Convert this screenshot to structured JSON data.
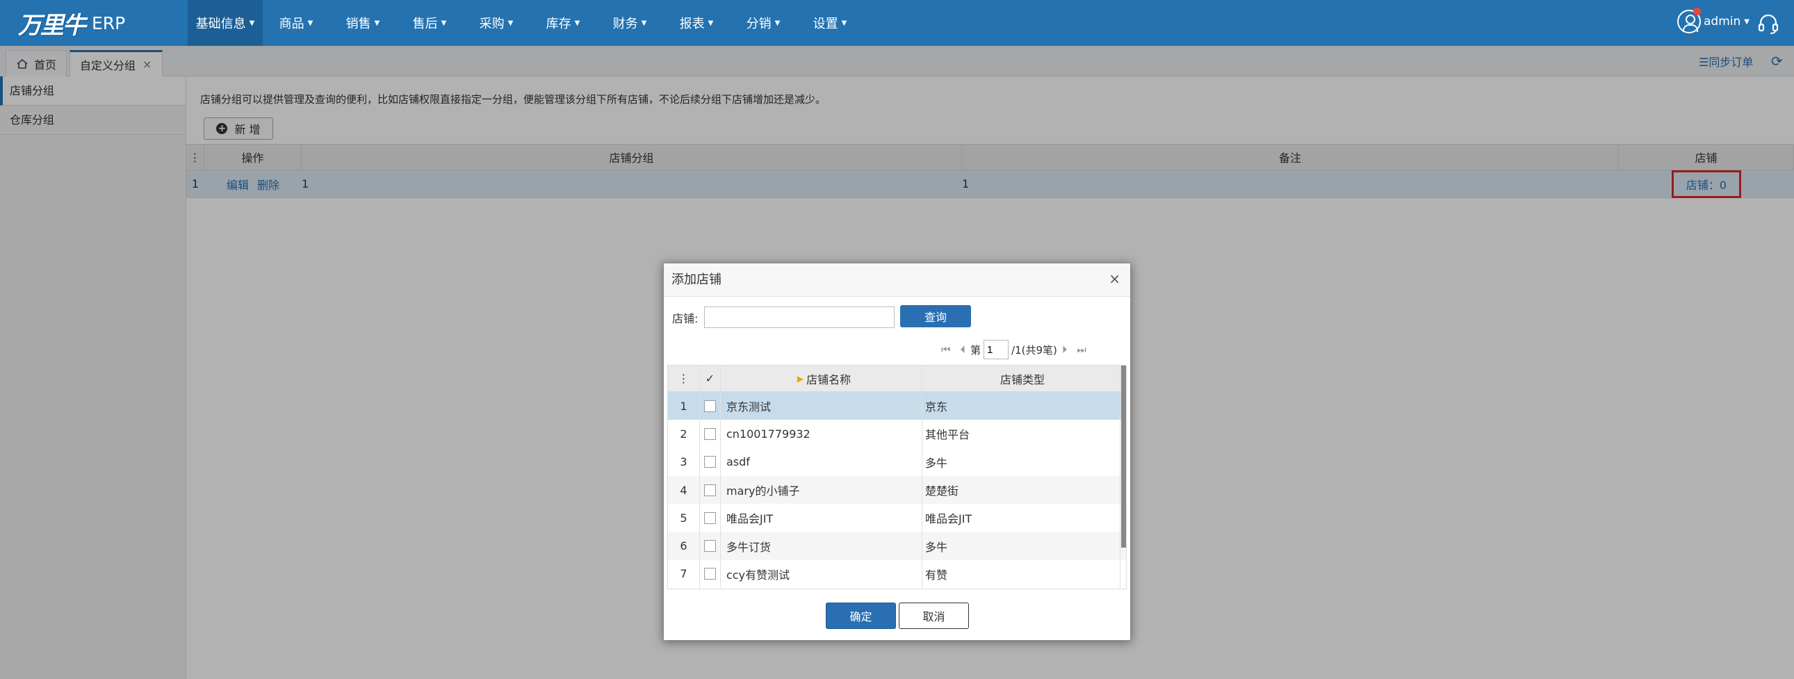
{
  "app": {
    "logo": "万里牛",
    "product": "ERP"
  },
  "nav": [
    {
      "label": "基础信息"
    },
    {
      "label": "商品"
    },
    {
      "label": "销售"
    },
    {
      "label": "售后"
    },
    {
      "label": "采购"
    },
    {
      "label": "库存"
    },
    {
      "label": "财务"
    },
    {
      "label": "报表"
    },
    {
      "label": "分销"
    },
    {
      "label": "设置"
    }
  ],
  "user": {
    "name": "admin"
  },
  "tabs": {
    "home": "首页",
    "active": "自定义分组",
    "close": "×"
  },
  "toolbar": {
    "sync": "☰同步订单"
  },
  "sidebar": [
    {
      "label": "店铺分组"
    },
    {
      "label": "仓库分组"
    }
  ],
  "main": {
    "description": "店铺分组可以提供管理及查询的便利，比如店铺权限直接指定一分组，便能管理该分组下所有店铺，不论后续分组下店铺增加还是减少。",
    "add_label": "新 增",
    "columns": {
      "op": "操作",
      "group": "店铺分组",
      "note": "备注",
      "shop": "店铺"
    },
    "row": {
      "index": "1",
      "edit": "编辑",
      "delete": "删除",
      "group": "1",
      "note": "1",
      "shop": "店铺：0"
    }
  },
  "dialog": {
    "title": "添加店铺",
    "close": "×",
    "search_label": "店铺:",
    "search_value": "",
    "search_button": "查询",
    "pager": {
      "prefix": "第",
      "page": "1",
      "suffix": "/1(共9笔)"
    },
    "columns": {
      "check": "✓",
      "name": "店铺名称",
      "type": "店铺类型"
    },
    "rows": [
      {
        "idx": "1",
        "name": "京东测试",
        "type": "京东"
      },
      {
        "idx": "2",
        "name": "cn1001779932",
        "type": "其他平台"
      },
      {
        "idx": "3",
        "name": "asdf",
        "type": "多牛"
      },
      {
        "idx": "4",
        "name": "mary的小铺子",
        "type": "楚楚街"
      },
      {
        "idx": "5",
        "name": "唯品会JIT",
        "type": "唯品会JIT"
      },
      {
        "idx": "6",
        "name": "多牛订货",
        "type": "多牛"
      },
      {
        "idx": "7",
        "name": "ccy有赞测试",
        "type": "有赞"
      }
    ],
    "ok": "确定",
    "cancel": "取消"
  },
  "colors": {
    "brand": "#2472b0",
    "link": "#2a6fb2",
    "highlight": "#e0262b",
    "badge": "#e8483a"
  }
}
